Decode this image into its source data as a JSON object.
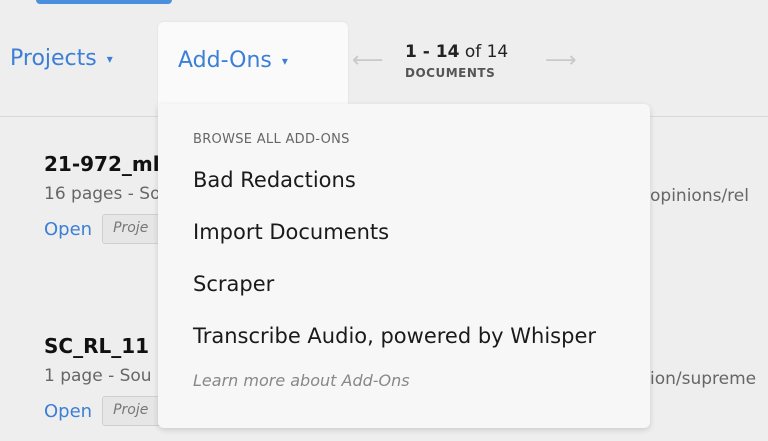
{
  "toolbar": {
    "projects_label": "Projects",
    "addons_label": "Add-Ons",
    "caret": "▾",
    "pager": {
      "range_start": "1",
      "range_end": "14",
      "of_text": "of 14",
      "label": "DOCUMENTS"
    },
    "prev_arrow": "⟵",
    "next_arrow": "⟶"
  },
  "documents": [
    {
      "title": "21-972_ml",
      "meta": "16 pages - So",
      "open_label": "Open",
      "project_chip": "Proje",
      "right_text": "opinions/rel"
    },
    {
      "title": "SC_RL_11",
      "meta": "1 page - Sou",
      "open_label": "Open",
      "project_chip": "Proje",
      "right_text": "ion/supreme"
    }
  ],
  "dropdown": {
    "heading": "BROWSE ALL ADD-ONS",
    "items": [
      "Bad Redactions",
      "Import Documents",
      "Scraper",
      "Transcribe Audio, powered by Whisper"
    ],
    "learn_more": "Learn more about Add-Ons"
  },
  "colors": {
    "accent": "#3b7fd6",
    "background": "#eeeeee",
    "dropdown_bg": "#f7f7f7"
  }
}
